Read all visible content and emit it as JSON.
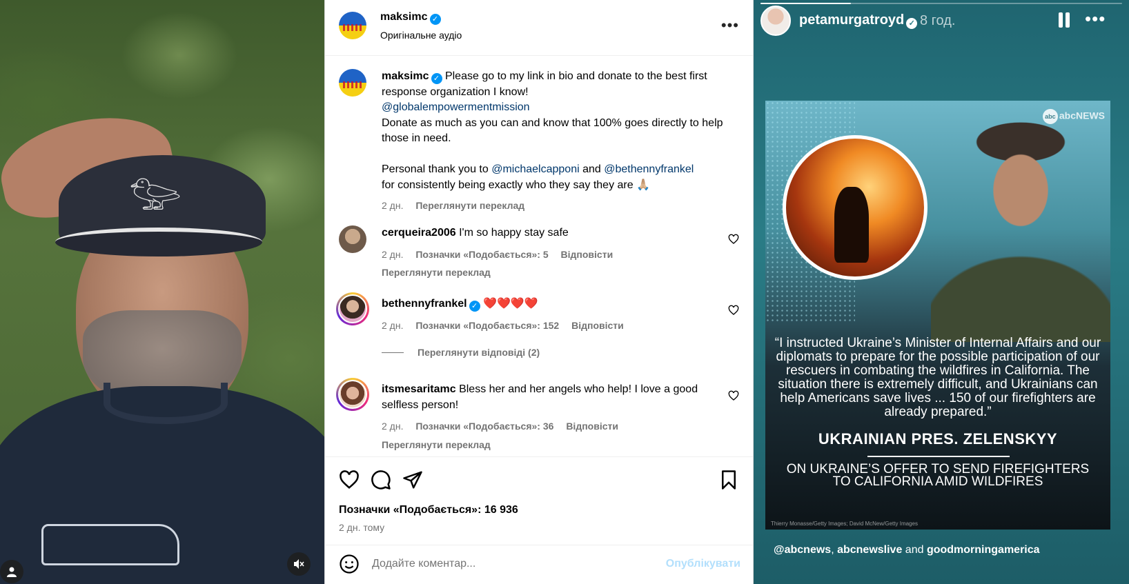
{
  "video": {
    "sound_icon": "speaker-muted-icon",
    "user_icon": "user-icon"
  },
  "post": {
    "author": "maksimc",
    "audio_label": "Оригінальне аудіо",
    "caption": {
      "line1": "Please go to my link in bio and donate to the best first response organization I know!",
      "mention1": "@globalempowermentmission",
      "line2": "Donate as much as you can and know that 100% goes directly to help those in need.",
      "thanks_prefix": "Personal thank you to ",
      "mention2": "@michaelcapponi",
      "and": " and ",
      "mention3": "@bethennyfrankel",
      "thanks_suffix": "for consistently being exactly who they say they are 🙏🏼",
      "time": "2 дн.",
      "translate": "Переглянути переклад"
    },
    "comments": [
      {
        "user": "cerqueira2006",
        "text": "I'm so happy stay safe",
        "time": "2 дн.",
        "likes": "Позначки «Подобається»: 5",
        "reply": "Відповісти",
        "translate": "Переглянути переклад"
      },
      {
        "user": "bethennyfrankel",
        "text": "❤️❤️❤️❤️",
        "time": "2 дн.",
        "likes": "Позначки «Подобається»: 152",
        "reply": "Відповісти",
        "view_replies": "Переглянути відповіді (2)"
      },
      {
        "user": "itsmesaritamc",
        "text": "Bless her and her angels who help! I love a good selfless person!",
        "time": "2 дн.",
        "likes": "Позначки «Подобається»: 36",
        "reply": "Відповісти",
        "translate": "Переглянути переклад"
      }
    ],
    "likes_total": "Позначки «Подобається»: 16 936",
    "posted_ago": "2 дн. тому",
    "comment_placeholder": "Додайте коментар...",
    "publish_label": "Опублікувати"
  },
  "story": {
    "user": "petamurgatroyd",
    "time": "8 год.",
    "progress": 0.25,
    "abc_logo": "abcNEWS",
    "abc_ball": "abc",
    "quote": "“I instructed Ukraine’s Minister of Internal Affairs and our diplomats to prepare for the possible participation of our rescuers in combating the wildfires in California. The situation there is extremely difficult, and Ukrainians can help Americans save lives ... 150 of our firefighters are already prepared.”",
    "speaker": "UKRAINIAN PRES. ZELENSKYY",
    "subcaption": "ON UKRAINE’S OFFER TO SEND FIREFIGHTERS TO CALIFORNIA AMID WILDFIRES",
    "credit": "Thierry Monasse/Getty Images; David McNew/Getty Images",
    "tag1": "@abcnews",
    "tag_sep": ", ",
    "tag2": "abcnewslive",
    "tag_and": " and ",
    "tag3": "goodmorningamerica"
  },
  "colors": {
    "mention": "#00376b",
    "verified": "#0095f6",
    "muted": "#737373",
    "publish_disabled": "#b2dffc",
    "story_bg": "#2a7c86"
  }
}
